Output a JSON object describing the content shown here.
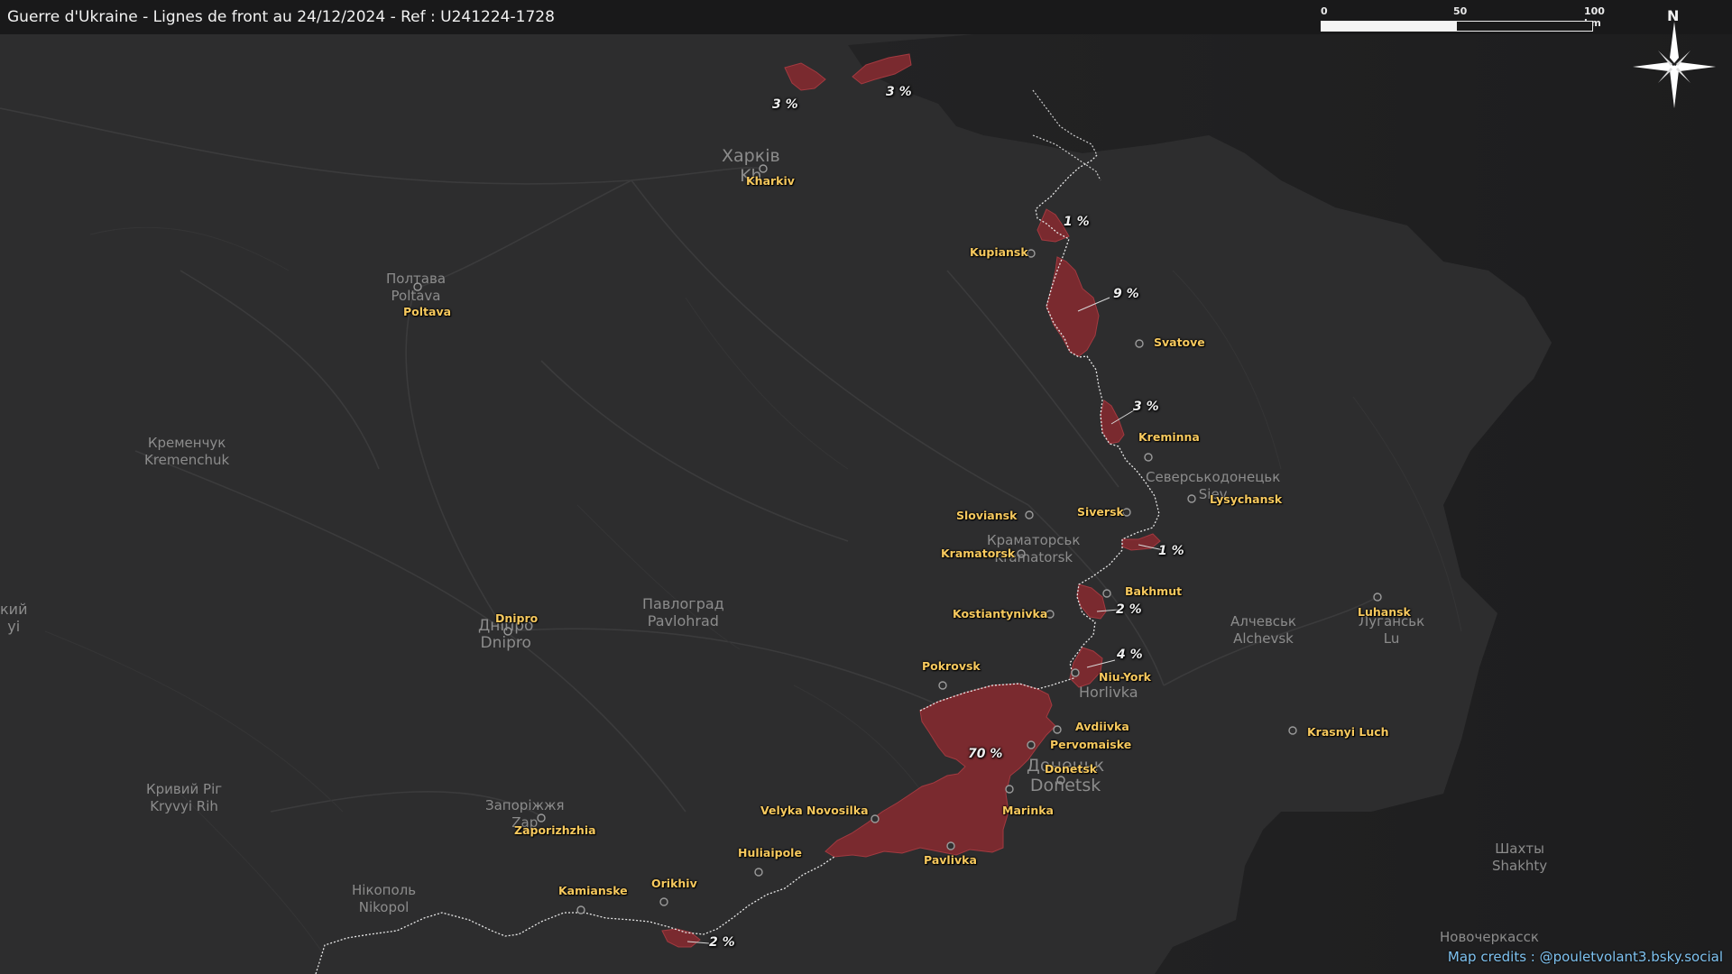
{
  "title": "Guerre d'Ukraine - Lignes de front au 24/12/2024 - Ref : U241224-1728",
  "scale": {
    "ticks": [
      "0",
      "50",
      "100 km"
    ]
  },
  "compass": {
    "north": "N",
    "icon": "north-arrow-icon"
  },
  "credits": "Map credits : @pouletvolant3.bsky.social",
  "colors": {
    "occupied": "#7a2a2f",
    "front_line": "#e8e8e8",
    "city_label": "#f7c95e",
    "credits": "#7ec2f0"
  },
  "cities": [
    {
      "name": "Kharkiv"
    },
    {
      "name": "Poltava"
    },
    {
      "name": "Kupiansk"
    },
    {
      "name": "Svatove"
    },
    {
      "name": "Kreminna"
    },
    {
      "name": "Lysychansk"
    },
    {
      "name": "Sloviansk"
    },
    {
      "name": "Siversk"
    },
    {
      "name": "Kramatorsk"
    },
    {
      "name": "Bakhmut"
    },
    {
      "name": "Kostiantynivka"
    },
    {
      "name": "Luhansk"
    },
    {
      "name": "Dnipro"
    },
    {
      "name": "Pokrovsk"
    },
    {
      "name": "Niu-York"
    },
    {
      "name": "Avdiivka"
    },
    {
      "name": "Pervomaiske"
    },
    {
      "name": "Donetsk"
    },
    {
      "name": "Marinka"
    },
    {
      "name": "Krasnyi Luch"
    },
    {
      "name": "Velyka Novosilka"
    },
    {
      "name": "Zaporizhzhia"
    },
    {
      "name": "Huliaipole"
    },
    {
      "name": "Pavlivka"
    },
    {
      "name": "Orikhiv"
    },
    {
      "name": "Kamianske"
    }
  ],
  "sectors": [
    {
      "label": "3 %"
    },
    {
      "label": "3 %"
    },
    {
      "label": "1 %"
    },
    {
      "label": "9 %"
    },
    {
      "label": "3 %"
    },
    {
      "label": "1 %"
    },
    {
      "label": "2 %"
    },
    {
      "label": "4 %"
    },
    {
      "label": "70 %"
    },
    {
      "label": "2 %"
    }
  ],
  "basemap_labels": [
    {
      "text": "Харків\nKh"
    },
    {
      "text": "Полтава\nPoltava"
    },
    {
      "text": "Кременчук\nKremenchuk"
    },
    {
      "text": "Павлоград\nPavlohrad"
    },
    {
      "text": "Дніпро\nDnipro"
    },
    {
      "text": "кий\nyi"
    },
    {
      "text": "Кривий Ріг\nKryvyi Rih"
    },
    {
      "text": "Запоріжжя\nZap"
    },
    {
      "text": "Нікополь\nNikopol"
    },
    {
      "text": "Северськодонецьк\nSiev"
    },
    {
      "text": "Краматорськ\nKramatorsk"
    },
    {
      "text": "Алчевськ\nAlchevsk"
    },
    {
      "text": "Луганськ\nLu"
    },
    {
      "text": "Horlivka"
    },
    {
      "text": "Донецьк\nDonetsk"
    },
    {
      "text": "Шахты\nShakhty"
    },
    {
      "text": "Новочеркасск"
    }
  ]
}
